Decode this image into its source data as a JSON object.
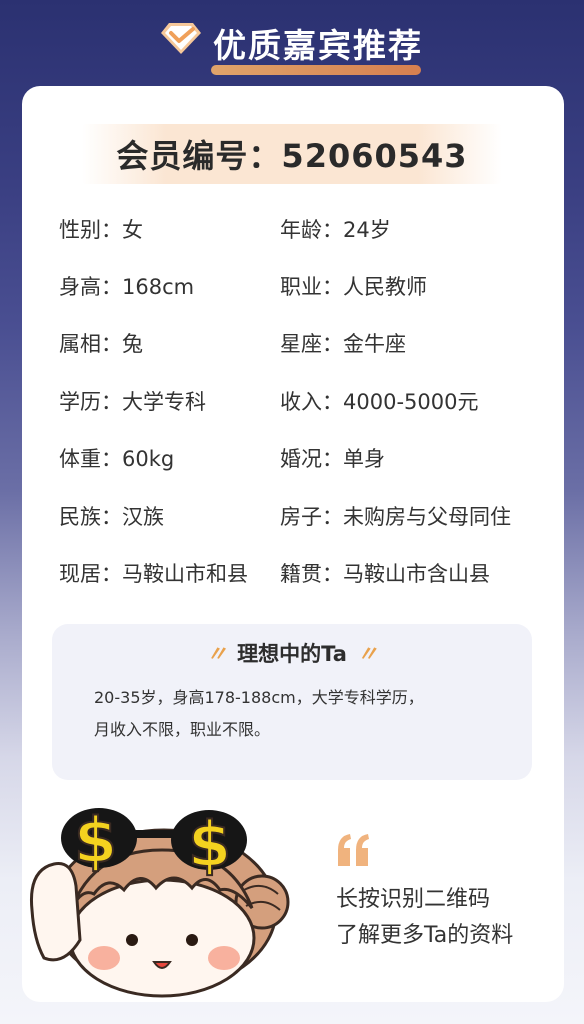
{
  "header": {
    "title": "优质嘉宾推荐",
    "icon": "diamond-badge-icon",
    "accent": "#e8874b"
  },
  "member": {
    "id_text": "会员编号：52060543"
  },
  "info": [
    {
      "left": "性别：女",
      "right": "年龄：24岁"
    },
    {
      "left": "身高：168cm",
      "right": "职业：人民教师"
    },
    {
      "left": "属相：兔",
      "right": "星座：金牛座"
    },
    {
      "left": "学历：大学专科",
      "right": "收入：4000-5000元"
    },
    {
      "left": "体重：60kg",
      "right": "婚况：单身"
    },
    {
      "left": "民族：汉族",
      "right": "房子：未购房与父母同住"
    },
    {
      "left": "现居：马鞍山市和县",
      "right": "籍贯：马鞍山市含山县"
    }
  ],
  "ideal": {
    "title": "理想中的Ta",
    "quote_left": "〃",
    "quote_right": "〃",
    "line1": "20-35岁，身高178-188cm，大学专科学历，",
    "line2": "月收入不限，职业不限。"
  },
  "qr": {
    "quote_icon": "quote-icon",
    "line1": "长按识别二维码",
    "line2": "了解更多Ta的资料"
  },
  "mascot": {
    "icon": "mascot-girl-icon",
    "dollar1": "$",
    "dollar2": "$"
  }
}
